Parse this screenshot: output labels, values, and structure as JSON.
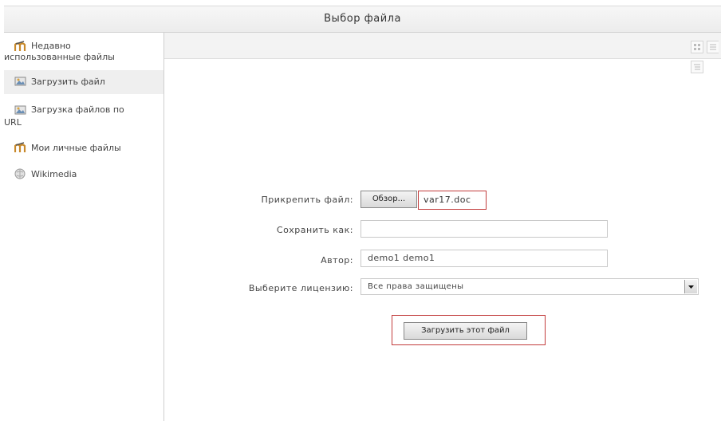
{
  "dialog": {
    "title": "Выбор файла"
  },
  "sidebar": {
    "items": [
      {
        "label_line1": "Недавно",
        "label_line2": "использованные файлы",
        "icon": "moodle-icon"
      },
      {
        "label": "Загрузить файл",
        "icon": "upload-icon"
      },
      {
        "label_line1": "Загрузка файлов по",
        "label_line2": "URL",
        "icon": "url-download-icon"
      },
      {
        "label": "Мои личные файлы",
        "icon": "moodle-icon"
      },
      {
        "label": "Wikimedia",
        "icon": "wikimedia-icon"
      }
    ]
  },
  "form": {
    "attach_label": "Прикрепить файл:",
    "browse_button": "Обзор...",
    "file_name": "var17.doc",
    "save_as_label": "Сохранить как:",
    "save_as_value": "",
    "author_label": "Автор:",
    "author_value": "demo1 demo1",
    "license_label": "Выберите лицензию:",
    "license_value": "Все права защищены",
    "upload_button": "Загрузить этот файл"
  },
  "colors": {
    "highlight": "#c23c3c"
  }
}
